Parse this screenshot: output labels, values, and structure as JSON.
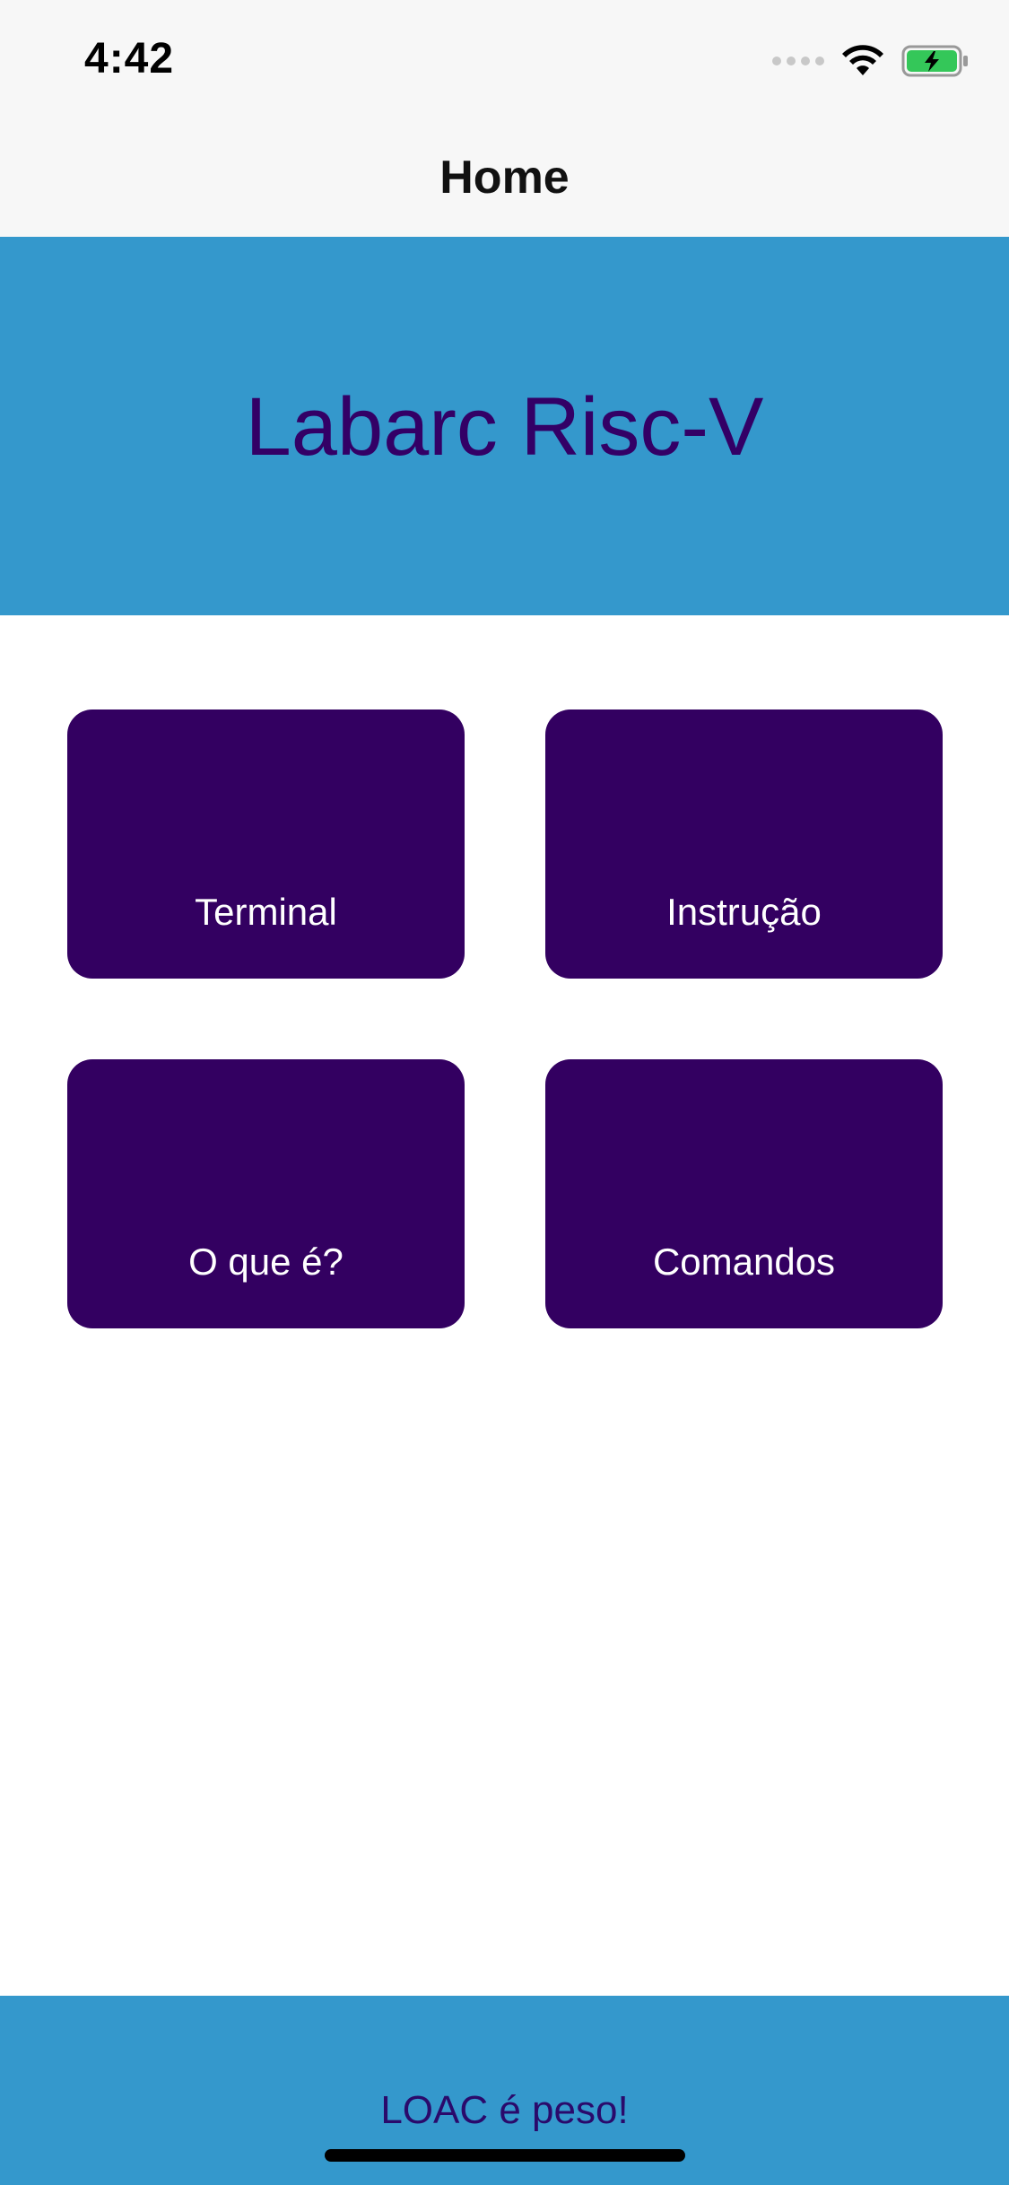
{
  "status_bar": {
    "time": "4:42",
    "icons": [
      "signal-dots-icon",
      "wifi-icon",
      "battery-charging-icon"
    ],
    "battery_color": "#34c759"
  },
  "nav": {
    "title": "Home"
  },
  "hero": {
    "title": "Labarc Risc-V",
    "background": "#3498cc",
    "text_color": "#330066"
  },
  "menu": {
    "tile_color": "#330061",
    "items": [
      {
        "label": "Terminal"
      },
      {
        "label": "Instrução"
      },
      {
        "label": "O que é?"
      },
      {
        "label": "Comandos"
      }
    ]
  },
  "footer": {
    "text": "LOAC é peso!"
  }
}
